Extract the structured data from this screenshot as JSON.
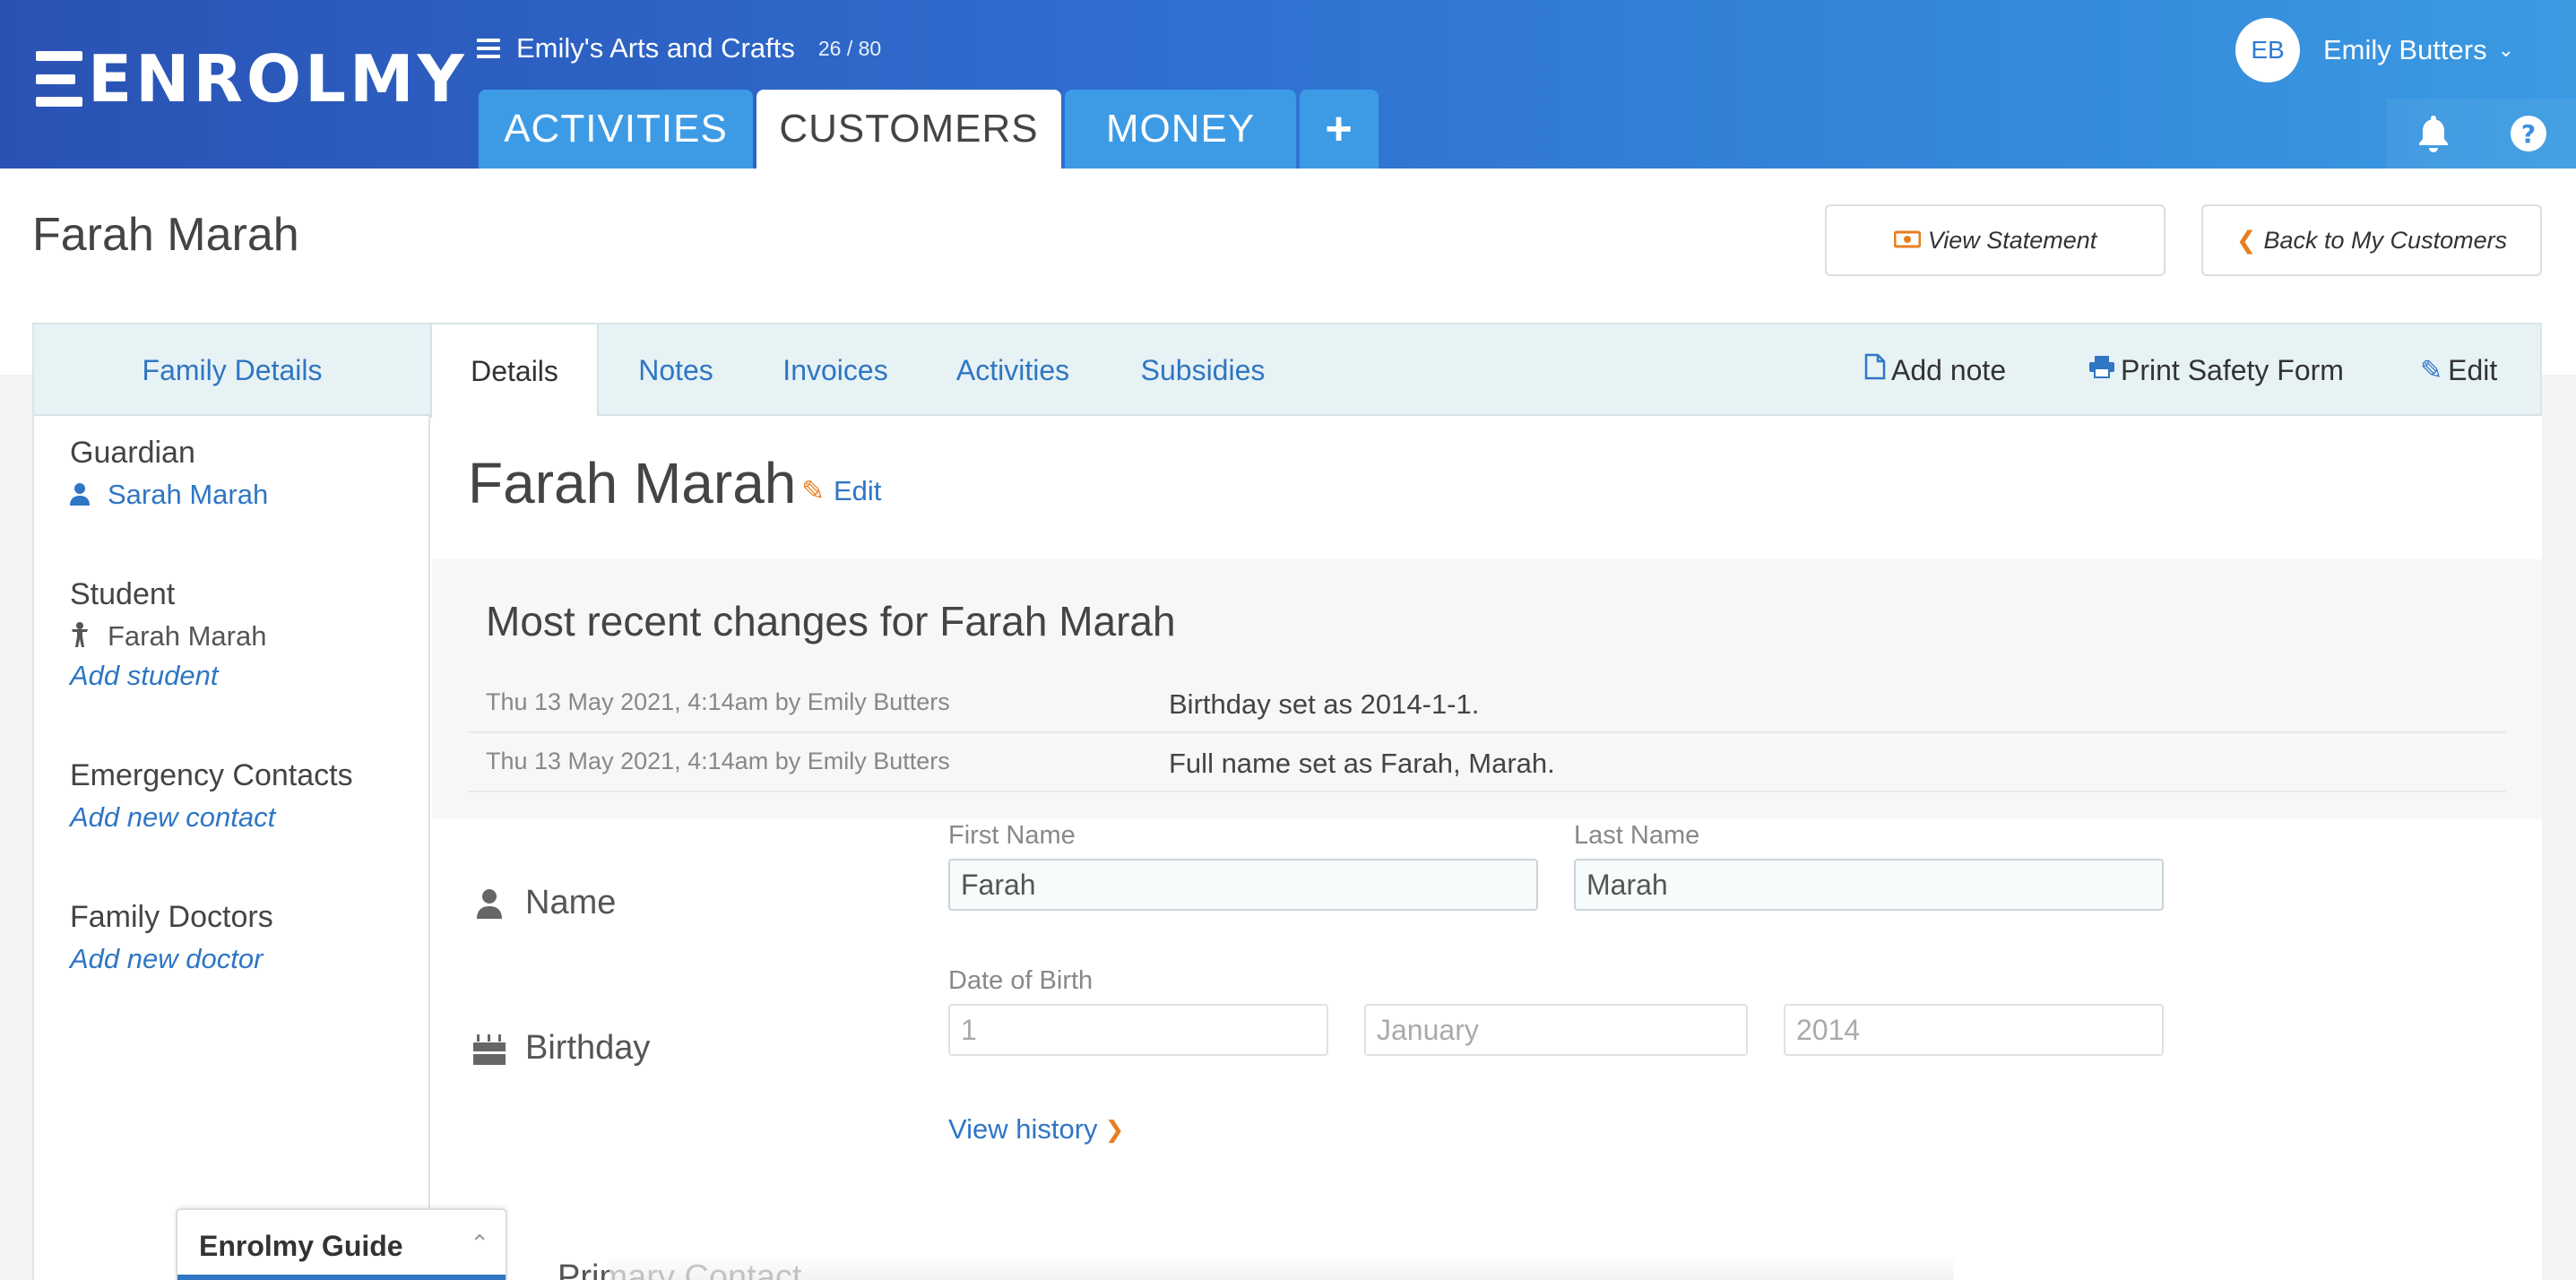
{
  "header": {
    "logo": "ENROLMY",
    "org_name": "Emily's Arts and Crafts",
    "org_count": "26 / 80",
    "nav": [
      {
        "label": "ACTIVITIES",
        "active": false
      },
      {
        "label": "CUSTOMERS",
        "active": true
      },
      {
        "label": "MONEY",
        "active": false
      }
    ],
    "plus_icon": "+",
    "user_initials": "EB",
    "user_name": "Emily Butters",
    "icons": [
      "bell-icon",
      "help-icon"
    ]
  },
  "page": {
    "title": "Farah Marah",
    "view_statement": "View Statement",
    "back": "Back to My Customers"
  },
  "tabs": {
    "family_details": "Family Details",
    "items": [
      "Details",
      "Notes",
      "Invoices",
      "Activities",
      "Subsidies"
    ],
    "active": "Details",
    "actions": {
      "add_note": "Add note",
      "print": "Print Safety Form",
      "edit": "Edit"
    }
  },
  "sidebar": {
    "guardian_heading": "Guardian",
    "guardian_name": "Sarah Marah",
    "student_heading": "Student",
    "student_name": "Farah Marah",
    "add_student": "Add student",
    "emergency_heading": "Emergency Contacts",
    "add_contact": "Add new contact",
    "doctors_heading": "Family Doctors",
    "add_doctor": "Add new doctor"
  },
  "content": {
    "title": "Farah Marah",
    "edit": "Edit",
    "changes_title": "Most recent changes for Farah Marah",
    "changes": [
      {
        "meta": "Thu 13 May 2021, 4:14am by Emily Butters",
        "desc": "Birthday set as 2014-1-1."
      },
      {
        "meta": "Thu 13 May 2021, 4:14am by Emily Butters",
        "desc": "Full name set as Farah, Marah."
      }
    ],
    "name_label": "Name",
    "first_name_label": "First Name",
    "first_name": "Farah",
    "last_name_label": "Last Name",
    "last_name": "Marah",
    "birthday_label": "Birthday",
    "dob_label": "Date of Birth",
    "dob_day": "1",
    "dob_month": "January",
    "dob_year": "2014",
    "view_history": "View history",
    "partial_heading": "Primary Contact"
  },
  "guide": {
    "title": "Enrolmy Guide"
  },
  "colors": {
    "link": "#2f76c4",
    "accent": "#e67e22",
    "header_start": "#2a52b4",
    "header_end": "#3a9ae2"
  }
}
